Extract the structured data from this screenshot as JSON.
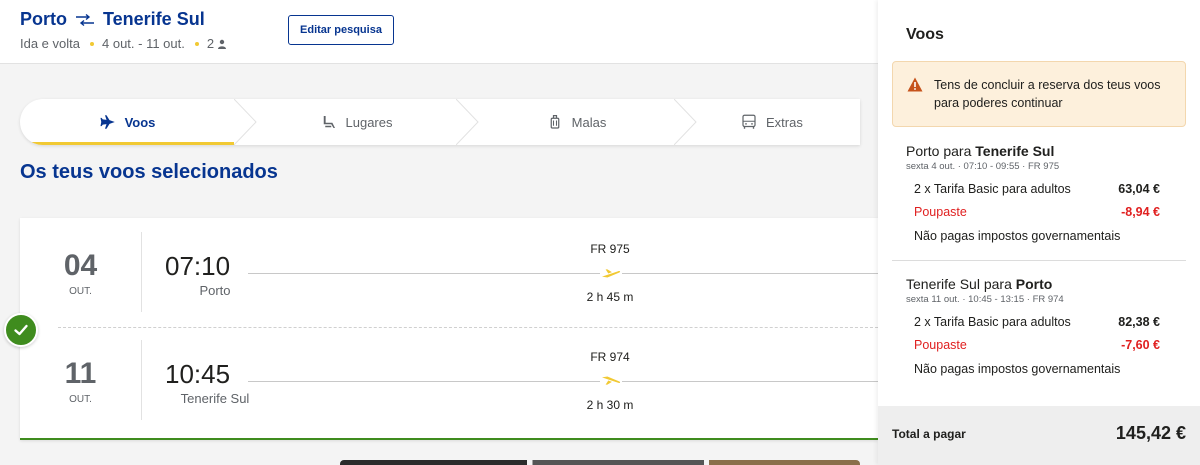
{
  "header": {
    "origin": "Porto",
    "destination": "Tenerife Sul",
    "trip_type": "Ida e volta",
    "dates": "4 out. - 11 out.",
    "passengers": "2",
    "edit_label": "Editar pesquisa"
  },
  "steps": [
    {
      "label": "Voos",
      "icon": "plane-icon",
      "active": true
    },
    {
      "label": "Lugares",
      "icon": "seat-icon",
      "active": false
    },
    {
      "label": "Malas",
      "icon": "luggage-icon",
      "active": false
    },
    {
      "label": "Extras",
      "icon": "bus-icon",
      "active": false
    }
  ],
  "section_title": "Os teus voos selecionados",
  "flights": [
    {
      "day": "04",
      "month": "OUT.",
      "time": "07:10",
      "city": "Porto",
      "flight_no": "FR 975",
      "duration": "2 h 45 m"
    },
    {
      "day": "11",
      "month": "OUT.",
      "time": "10:45",
      "city": "Tenerife Sul",
      "flight_no": "FR 974",
      "duration": "2 h 30 m"
    }
  ],
  "sidebar": {
    "title": "Voos",
    "warning": "Tens de concluir a reserva dos teus voos para poderes continuar",
    "legs": [
      {
        "from": "Porto",
        "connector": "para",
        "to": "Tenerife Sul",
        "subtitle": "sexta 4 out. · 07:10 - 09:55 · FR 975",
        "fare_label": "2 x Tarifa Basic para adultos",
        "fare_amount": "63,04 €",
        "saving_label": "Poupaste",
        "saving_amount": "-8,94 €",
        "tax_note": "Não pagas impostos governamentais"
      },
      {
        "from": "Tenerife Sul",
        "connector": "para",
        "to": "Porto",
        "subtitle": "sexta 11 out. · 10:45 - 13:15 · FR 974",
        "fare_label": "2 x Tarifa Basic para adultos",
        "fare_amount": "82,38 €",
        "saving_label": "Poupaste",
        "saving_amount": "-7,60 €",
        "tax_note": "Não pagas impostos governamentais"
      }
    ],
    "total_label": "Total a pagar",
    "total_amount": "145,42 €"
  },
  "colors": {
    "brand_blue": "#073590",
    "accent_yellow": "#f1c933",
    "success_green": "#3f8c1e",
    "saving_red": "#e02020",
    "warning_bg": "#fdf0dc"
  }
}
